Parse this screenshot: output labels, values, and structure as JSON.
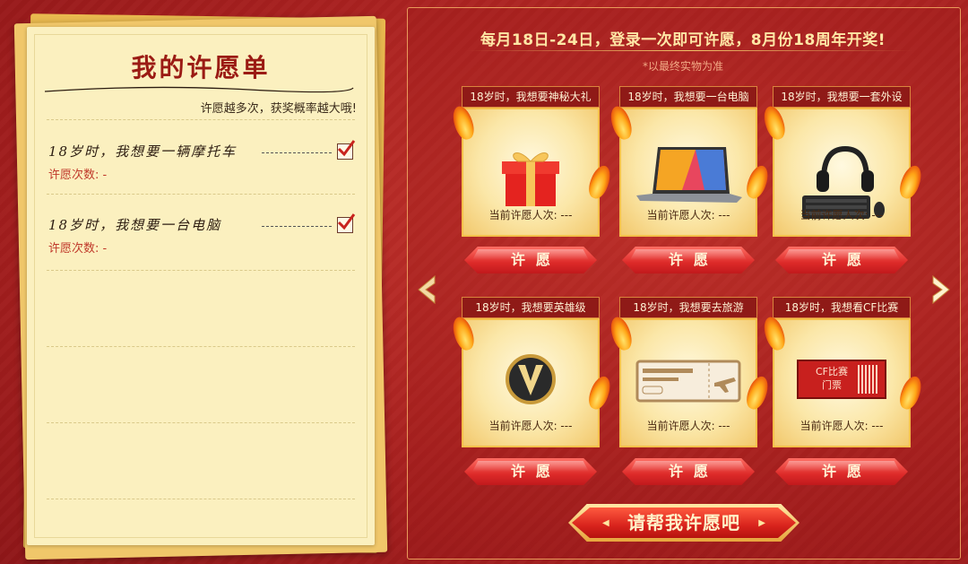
{
  "wishlist": {
    "title": "我的许愿单",
    "subtitle": "许愿越多次，获奖概率越大哦!",
    "items": [
      {
        "text": "18岁时，我想要一辆摩托车",
        "count_label": "许愿次数: -"
      },
      {
        "text": "18岁时，我想要一台电脑",
        "count_label": "许愿次数: -"
      }
    ]
  },
  "panel": {
    "headline": "每月18日-24日，登录一次即可许愿，8月份18周年开奖!",
    "note": "*以最终实物为准",
    "button_label": "许愿",
    "big_button_label": "请帮我许愿吧",
    "cards": [
      {
        "label": "18岁时，我想要神秘大礼",
        "icon": "gift-box-icon",
        "count": "当前许愿人次: ---"
      },
      {
        "label": "18岁时，我想要一台电脑",
        "icon": "laptop-icon",
        "count": "当前许愿人次: ---"
      },
      {
        "label": "18岁时，我想要一套外设",
        "icon": "headset-keyboard-mouse-icon",
        "count": "当前许愿人次: ---"
      },
      {
        "label": "18岁时，我想要英雄级",
        "icon": "hero-v-badge-icon",
        "count": "当前许愿人次: ---"
      },
      {
        "label": "18岁时，我想要去旅游",
        "icon": "plane-ticket-icon",
        "count": "当前许愿人次: ---"
      },
      {
        "label": "18岁时，我想看CF比赛",
        "icon": "cf-ticket-icon",
        "count": "当前许愿人次: ---",
        "ticket_text": "CF比赛\n门票"
      }
    ]
  },
  "nav": {
    "prev_icon": "arrow-left-icon",
    "next_icon": "arrow-right-icon"
  },
  "colors": {
    "primary_red": "#d8231c",
    "gold": "#f4c04a",
    "paper": "#fbf0bf"
  }
}
